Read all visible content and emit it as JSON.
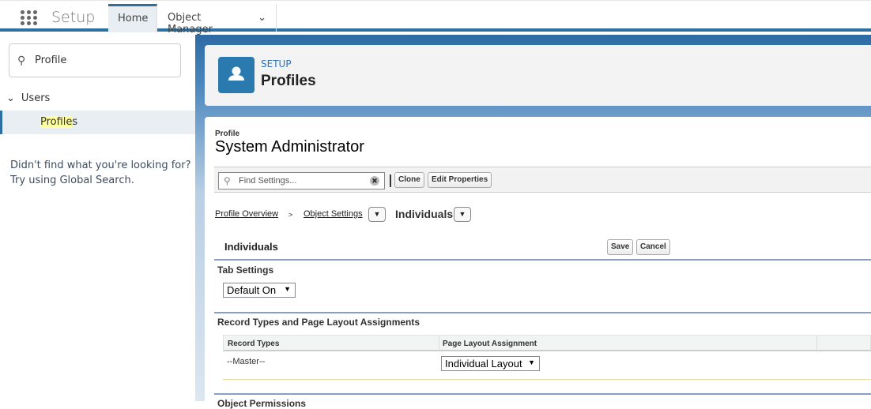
{
  "topbar": {
    "app_name": "Setup",
    "tabs": [
      {
        "label": "Home",
        "active": true
      },
      {
        "label": "Object Manager",
        "has_dropdown": true
      }
    ],
    "accent": "#2c6fa0"
  },
  "sidebar": {
    "search_value": "Profile",
    "group": "Users",
    "item": "Profiles",
    "item_highlight": "Profile",
    "item_rest": "s",
    "hint_line1": "Didn't find what you're looking for?",
    "hint_line2": "Try using Global Search."
  },
  "header": {
    "subtitle": "SETUP",
    "title": "Profiles",
    "icon": "user-icon"
  },
  "profile": {
    "label": "Profile",
    "name": "System Administrator"
  },
  "toolbar": {
    "find_placeholder": "Find Settings...",
    "clone": "Clone",
    "edit_properties": "Edit Properties"
  },
  "breadcrumb": {
    "overview": "Profile Overview",
    "separator": ">",
    "object_settings": "Object Settings",
    "current": "Individuals"
  },
  "section": {
    "title": "Individuals",
    "save": "Save",
    "cancel": "Cancel",
    "tab_settings": {
      "heading": "Tab Settings",
      "value": "Default On"
    },
    "record_types": {
      "heading": "Record Types and Page Layout Assignments",
      "columns": [
        "Record Types",
        "Page Layout Assignment"
      ],
      "rows": [
        {
          "record_type": "--Master--",
          "layout": "Individual Layout"
        }
      ]
    },
    "next_heading": "Object Permissions"
  }
}
